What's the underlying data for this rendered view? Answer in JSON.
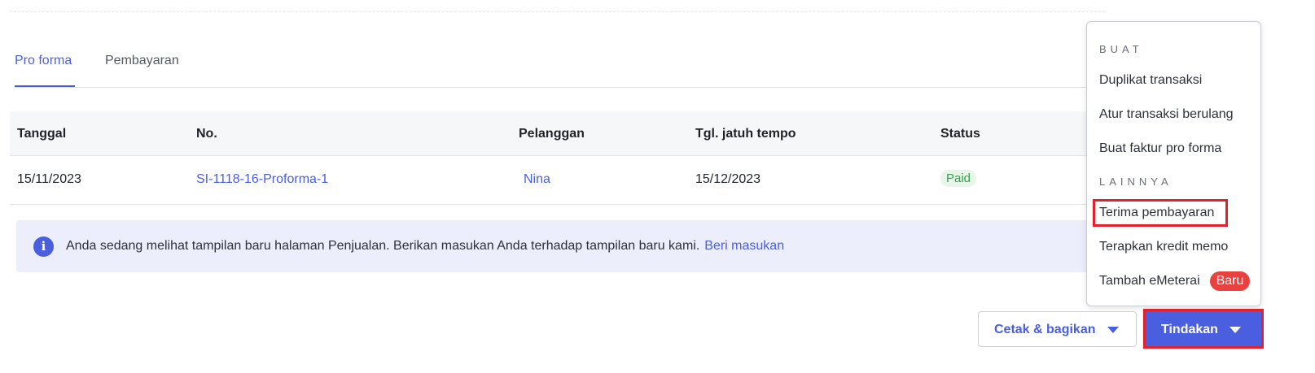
{
  "tabs": [
    {
      "label": "Pro forma",
      "active": true
    },
    {
      "label": "Pembayaran",
      "active": false
    }
  ],
  "table": {
    "columns": [
      "Tanggal",
      "No.",
      "Pelanggan",
      "Tgl. jatuh tempo",
      "Status"
    ],
    "rows": [
      {
        "tanggal": "15/11/2023",
        "no": "SI-1118-16-Proforma-1",
        "pelanggan": "Nina",
        "jatuh_tempo": "15/12/2023",
        "status": "Paid"
      }
    ]
  },
  "info": {
    "icon": "info-icon",
    "text": "Anda sedang melihat tampilan baru halaman Penjualan. Berikan masukan Anda terhadap tampilan baru kami.",
    "link": "Beri masukan"
  },
  "menu": {
    "section_buat": "BUAT",
    "buat_items": [
      "Duplikat transaksi",
      "Atur transaksi berulang",
      "Buat faktur pro forma"
    ],
    "section_lainnya": "LAINNYA",
    "lainnya_items": [
      "Terima pembayaran",
      "Terapkan kredit memo",
      "Tambah eMeterai"
    ],
    "new_badge": "Baru"
  },
  "buttons": {
    "secondary": "Cetak & bagikan",
    "primary": "Tindakan"
  },
  "colors": {
    "accent": "#4a5ee0",
    "highlight": "#e3212b",
    "paid_bg": "#e8f6ea",
    "paid_text": "#3a9c50",
    "badge_new": "#e8413f",
    "info_bg": "#eceefb"
  }
}
